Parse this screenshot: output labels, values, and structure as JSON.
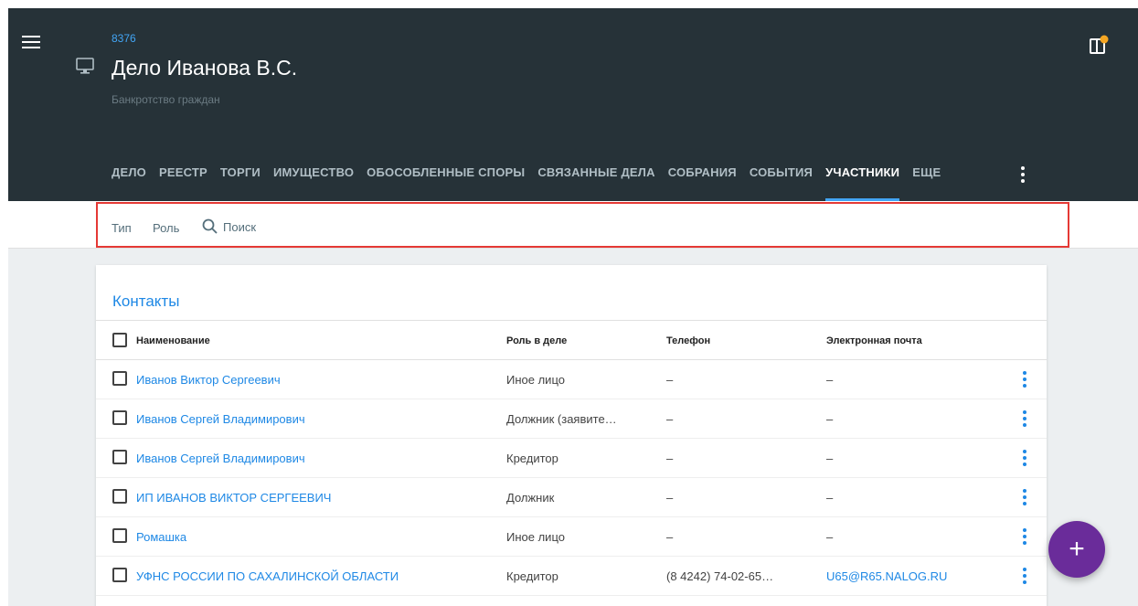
{
  "header": {
    "case_number": "8376",
    "case_title": "Дело Иванова В.С.",
    "case_subtitle": "Банкротство граждан"
  },
  "tabs": [
    {
      "label": "ДЕЛО"
    },
    {
      "label": "РЕЕСТР"
    },
    {
      "label": "ТОРГИ"
    },
    {
      "label": "ИМУЩЕСТВО"
    },
    {
      "label": "ОБОСОБЛЕННЫЕ СПОРЫ"
    },
    {
      "label": "СВЯЗАННЫЕ ДЕЛА"
    },
    {
      "label": "СОБРАНИЯ"
    },
    {
      "label": "СОБЫТИЯ"
    },
    {
      "label": "УЧАСТНИКИ",
      "active": true
    },
    {
      "label": "ЕЩЕ"
    }
  ],
  "filters": {
    "type_label": "Тип",
    "role_label": "Роль",
    "search_placeholder": "Поиск",
    "search_value": ""
  },
  "contacts": {
    "title": "Контакты",
    "columns": {
      "name": "Наименование",
      "role": "Роль в деле",
      "phone": "Телефон",
      "email": "Электронная почта"
    },
    "rows": [
      {
        "name": "Иванов Виктор Сергеевич",
        "role": "Иное лицо",
        "phone": "–",
        "email": "–"
      },
      {
        "name": "Иванов Сергей Владимирович",
        "role": "Должник (заявите…",
        "phone": "–",
        "email": "–"
      },
      {
        "name": "Иванов Сергей Владимирович",
        "role": "Кредитор",
        "phone": "–",
        "email": "–"
      },
      {
        "name": "ИП ИВАНОВ ВИКТОР СЕРГЕЕВИЧ",
        "role": "Должник",
        "phone": "–",
        "email": "–"
      },
      {
        "name": "Ромашка",
        "role": "Иное лицо",
        "phone": "–",
        "email": "–"
      },
      {
        "name": "УФНС РОССИИ ПО САХАЛИНСКОЙ ОБЛАСТИ",
        "role": "Кредитор",
        "phone": "(8 4242) 74-02-65…",
        "email": "U65@R65.NALOG.RU"
      }
    ]
  },
  "fab": {
    "label": "+"
  },
  "colors": {
    "header_bg": "#263238",
    "accent_blue": "#1e88e5",
    "tab_indicator": "#42a5f5",
    "highlight_border": "#e53935",
    "fab_bg": "#6a2c9a",
    "notification_dot": "#f5a623"
  },
  "icons": {
    "menu": "hamburger-menu-icon",
    "case": "monitor-icon",
    "panel": "panel-toggle-icon",
    "tabs_more": "vertical-dots-icon",
    "search": "search-icon",
    "row_menu": "vertical-dots-icon",
    "fab": "plus-icon"
  }
}
